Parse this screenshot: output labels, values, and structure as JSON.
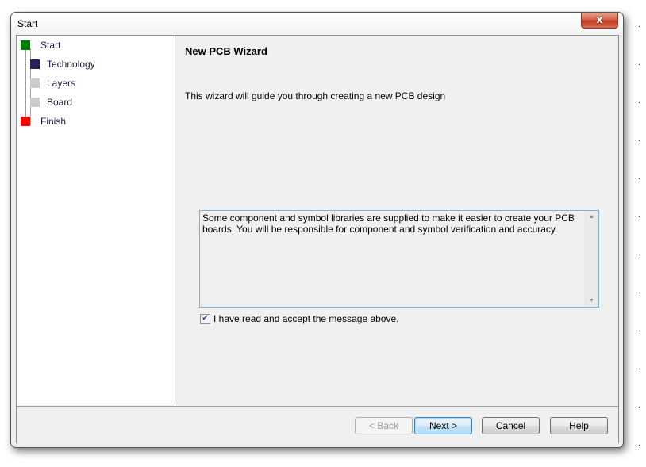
{
  "window": {
    "title": "Start",
    "close_label": "x"
  },
  "sidebar": {
    "steps": [
      {
        "label": "Start",
        "color": "#008000",
        "level": 0
      },
      {
        "label": "Technology",
        "color": "#2a1f5c",
        "level": 1
      },
      {
        "label": "Layers",
        "color": "#cccccc",
        "level": 1
      },
      {
        "label": "Board",
        "color": "#cccccc",
        "level": 1
      },
      {
        "label": "Finish",
        "color": "#ff0000",
        "level": 0
      }
    ]
  },
  "main": {
    "heading": "New PCB Wizard",
    "intro": "This wizard will guide you through creating a new PCB design",
    "message": "Some component and symbol libraries are supplied to make it easier to create your PCB boards. You will be responsible for component and symbol verification and accuracy.",
    "accept_checkbox": {
      "label": "I have read and accept the message above.",
      "checked": true,
      "check_glyph": "✔"
    }
  },
  "footer": {
    "back_label": "< Back",
    "next_label": "Next >",
    "cancel_label": "Cancel",
    "help_label": "Help"
  },
  "scroll": {
    "up_glyph": "▲",
    "down_glyph": "▼"
  }
}
